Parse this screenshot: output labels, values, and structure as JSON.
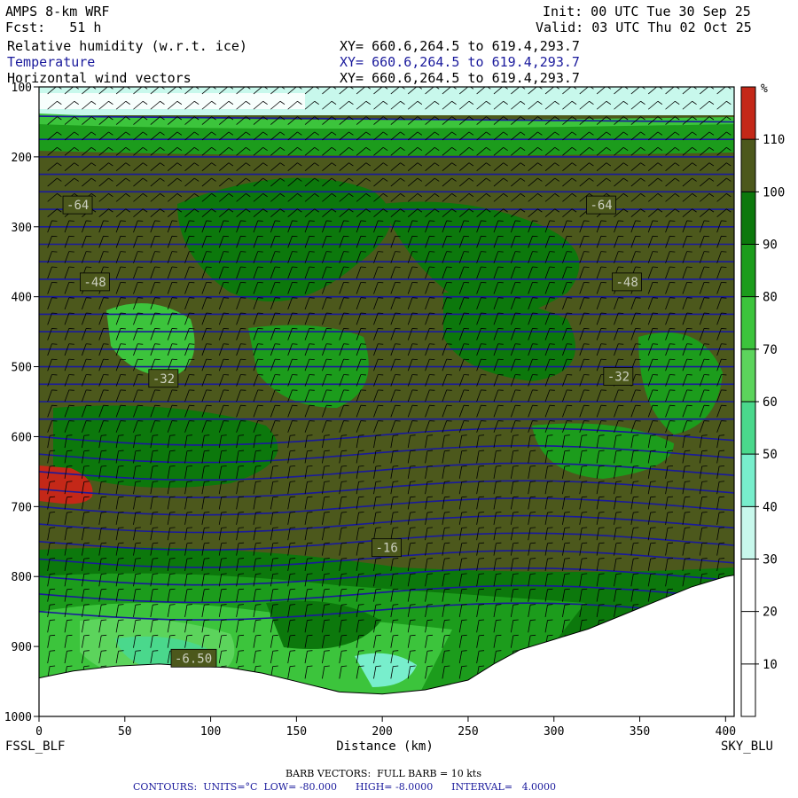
{
  "header": {
    "model": "AMPS 8-km WRF",
    "fcst": "Fcst:   51 h",
    "init": "Init: 00 UTC Tue 30 Sep 25",
    "valid": "Valid: 03 UTC Thu 02 Oct 25",
    "fields": [
      {
        "name": "Relative humidity (w.r.t. ice)",
        "xy": "XY= 660.6,264.5 to 619.4,293.7"
      },
      {
        "name": "Temperature",
        "xy": "XY= 660.6,264.5 to 619.4,293.7"
      },
      {
        "name": "Horizontal wind vectors",
        "xy": "XY= 660.6,264.5 to 619.4,293.7"
      }
    ]
  },
  "chart_data": {
    "type": "heatmap",
    "title": "AMPS 8-km WRF",
    "xlabel": "Distance (km)",
    "ylabel": "",
    "xlim": [
      0,
      405
    ],
    "ylim": [
      1000,
      100
    ],
    "xticks": [
      0,
      50,
      100,
      150,
      200,
      250,
      300,
      350,
      400
    ],
    "yticks": [
      100,
      200,
      300,
      400,
      500,
      600,
      700,
      800,
      900,
      1000
    ],
    "start_label": "FSSL_BLF",
    "end_label": "SKY_BLU",
    "colorbar": {
      "unit": "%",
      "levels": [
        10,
        20,
        30,
        40,
        50,
        60,
        70,
        80,
        90,
        100,
        110
      ],
      "colors": [
        "#ffffff",
        "#ffffff",
        "#ffffff",
        "#c8f8ec",
        "#78eecc",
        "#4ad88c",
        "#5cd45c",
        "#3cc43c",
        "#1c9c1c",
        "#0c780c",
        "#4c581c",
        "#c42818"
      ]
    },
    "terrain": [
      [
        0,
        945
      ],
      [
        20,
        935
      ],
      [
        45,
        928
      ],
      [
        70,
        925
      ],
      [
        90,
        928
      ],
      [
        110,
        930
      ],
      [
        130,
        938
      ],
      [
        150,
        950
      ],
      [
        175,
        965
      ],
      [
        200,
        968
      ],
      [
        225,
        962
      ],
      [
        250,
        948
      ],
      [
        265,
        925
      ],
      [
        280,
        905
      ],
      [
        300,
        890
      ],
      [
        320,
        875
      ],
      [
        340,
        855
      ],
      [
        360,
        835
      ],
      [
        380,
        815
      ],
      [
        400,
        800
      ],
      [
        405,
        798
      ]
    ],
    "temperature_labels": [
      {
        "text": "-64",
        "x": 15,
        "p": 270
      },
      {
        "text": "-64",
        "x": 320,
        "p": 270
      },
      {
        "text": "-48",
        "x": 25,
        "p": 380
      },
      {
        "text": "-48",
        "x": 335,
        "p": 380
      },
      {
        "text": "-32",
        "x": 65,
        "p": 518
      },
      {
        "text": "-32",
        "x": 330,
        "p": 515
      },
      {
        "text": "-16",
        "x": 195,
        "p": 760
      },
      {
        "text": "-6.50",
        "x": 78,
        "p": 918
      }
    ],
    "contours": {
      "units": "°C",
      "low": "-80.000",
      "high": "-8.0000",
      "interval": "4.0000"
    }
  },
  "footer": {
    "barb": "BARB VECTORS:  FULL BARB = 10 kts",
    "contours_label": "CONTOURS:  UNITS=°C  LOW= -80.000      HIGH= -8.0000      INTERVAL=   4.0000"
  },
  "colors": {
    "olive": "#4c581c",
    "contour": "#1a1a9c",
    "frame": "#000000"
  }
}
